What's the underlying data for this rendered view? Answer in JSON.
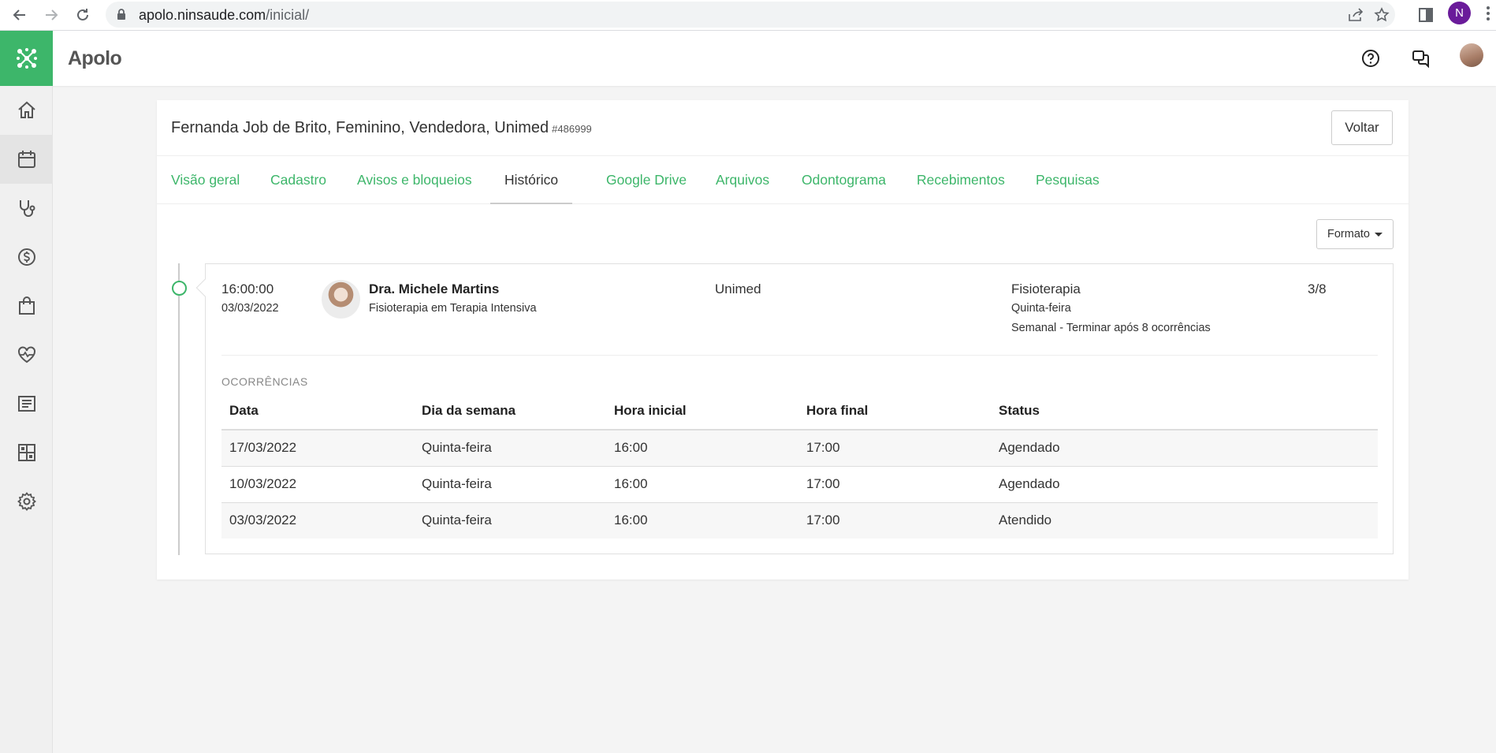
{
  "browser": {
    "url_host": "apolo.ninsaude.com",
    "url_path": "/inicial/",
    "profile_initial": "N"
  },
  "header": {
    "app_name": "Apolo"
  },
  "sidebar": {
    "items": [
      "home-icon",
      "calendar-icon",
      "stethoscope-icon",
      "dollar-icon",
      "bag-icon",
      "heartbeat-icon",
      "report-icon",
      "dashboard-icon",
      "gear-icon"
    ],
    "active_index": 1
  },
  "patient": {
    "title": "Fernanda Job de Brito, Feminino, Vendedora, Unimed",
    "id": "#486999"
  },
  "buttons": {
    "back": "Voltar",
    "format": "Formato"
  },
  "tabs": [
    {
      "label": "Visão geral",
      "active": false
    },
    {
      "label": "Cadastro",
      "active": false
    },
    {
      "label": "Avisos e bloqueios",
      "active": false
    },
    {
      "label": "Histórico",
      "active": true
    },
    {
      "label": "Google Drive",
      "active": false
    },
    {
      "label": "Arquivos",
      "active": false
    },
    {
      "label": "Odontograma",
      "active": false
    },
    {
      "label": "Recebimentos",
      "active": false
    },
    {
      "label": "Pesquisas",
      "active": false
    }
  ],
  "entry": {
    "time": "16:00:00",
    "date": "03/03/2022",
    "doctor": "Dra. Michele Martins",
    "specialty": "Fisioterapia em Terapia Intensiva",
    "insurance": "Unimed",
    "service": "Fisioterapia",
    "weekday": "Quinta-feira",
    "recurrence": "Semanal",
    "recurrence_end": "- Terminar após 8 ocorrências",
    "count": "3/8",
    "section_title": "OCORRÊNCIAS",
    "columns": [
      "Data",
      "Dia da semana",
      "Hora inicial",
      "Hora final",
      "Status"
    ],
    "rows": [
      [
        "17/03/2022",
        "Quinta-feira",
        "16:00",
        "17:00",
        "Agendado"
      ],
      [
        "10/03/2022",
        "Quinta-feira",
        "16:00",
        "17:00",
        "Agendado"
      ],
      [
        "03/03/2022",
        "Quinta-feira",
        "16:00",
        "17:00",
        "Atendido"
      ]
    ]
  },
  "colors": {
    "brand_green": "#3db66a",
    "text": "#333333"
  }
}
